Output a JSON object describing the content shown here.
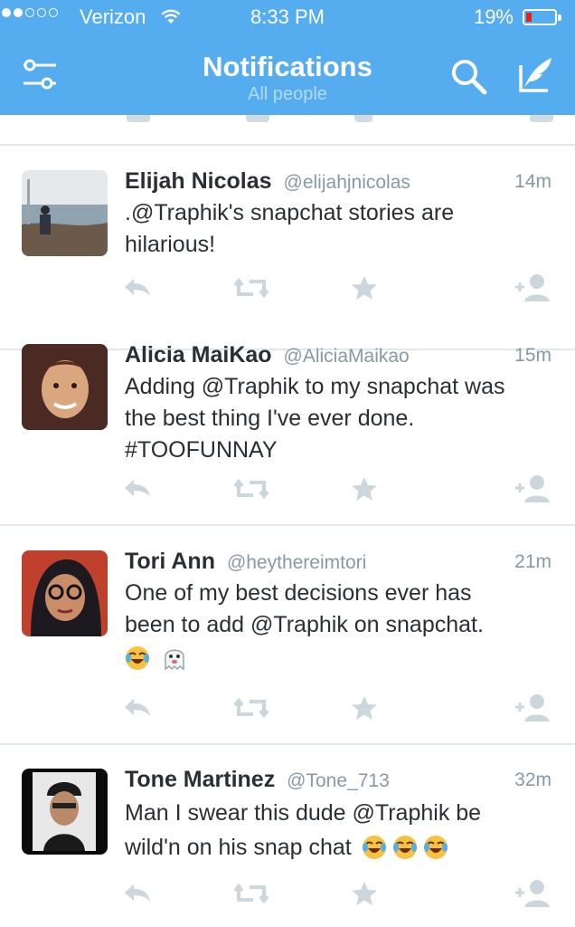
{
  "status_bar": {
    "carrier": "Verizon",
    "time": "8:33 PM",
    "battery": "19%",
    "battery_level": 0.19
  },
  "header": {
    "title": "Notifications",
    "subtitle": "All people",
    "icons": [
      "filter-icon",
      "search-icon",
      "compose-icon"
    ]
  },
  "tweets": [
    {
      "name": "Elijah Nicolas",
      "handle": "@elijahjnicolas",
      "age": "14m",
      "lines": [
        ".@Traphik's snapchat stories are",
        "hilarious!"
      ]
    },
    {
      "name": "Alicia MaiKao",
      "handle": "@AliciaMaikao",
      "age": "15m",
      "lines": [
        "Adding @Traphik to my snapchat was",
        "the best thing I've ever done.",
        "#TOOFUNNAY"
      ]
    },
    {
      "name": "Tori Ann",
      "handle": "@heythereimtori",
      "age": "21m",
      "lines": [
        "One of my best decisions ever has",
        "been to add @Traphik on snapchat."
      ],
      "emoji": [
        "face-with-tears-of-joy",
        "ghost"
      ]
    },
    {
      "name": "Tone Martinez",
      "handle": "@Tone_713",
      "age": "32m",
      "lines": [
        "Man I swear this dude @Traphik be",
        "wild'n on his snap chat"
      ],
      "emoji_inline": [
        "face-with-tears-of-joy",
        "face-with-tears-of-joy",
        "face-with-tears-of-joy"
      ]
    }
  ],
  "colors": {
    "header": "#55acee",
    "icon_gray": "#ccd6dd",
    "handle_gray": "#8899a6",
    "battery_low": "#e0231f"
  }
}
